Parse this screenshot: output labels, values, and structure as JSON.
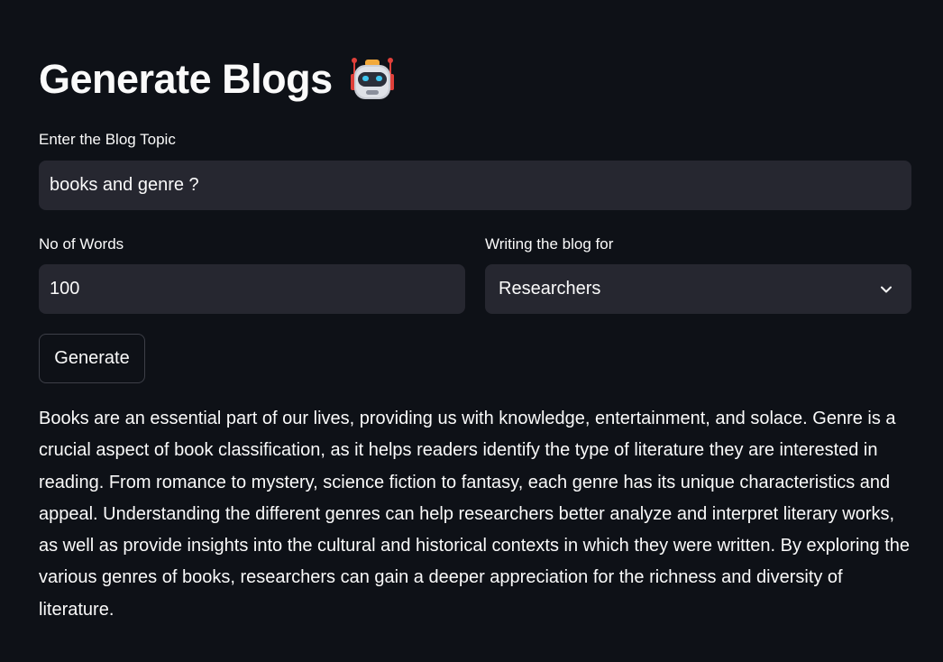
{
  "page": {
    "title": "Generate Blogs",
    "title_icon": "robot-icon"
  },
  "form": {
    "topic_label": "Enter the Blog Topic",
    "topic_value": "books and genre ?",
    "words_label": "No of Words",
    "words_value": "100",
    "audience_label": "Writing the blog for",
    "audience_value": "Researchers",
    "audience_icon": "chevron-down-icon",
    "generate_label": "Generate"
  },
  "output": {
    "text": "Books are an essential part of our lives, providing us with knowledge, entertainment, and solace. Genre is a crucial aspect of book classification, as it helps readers identify the type of literature they are interested in reading. From romance to mystery, science fiction to fantasy, each genre has its unique characteristics and appeal. Understanding the different genres can help researchers better analyze and interpret literary works, as well as provide insights into the cultural and historical contexts in which they were written. By exploring the various genres of books, researchers can gain a deeper appreciation for the richness and diversity of literature."
  },
  "colors": {
    "background": "#0e1117",
    "field_background": "#262730",
    "text": "#fafafa",
    "button_border": "#3d3f48"
  }
}
